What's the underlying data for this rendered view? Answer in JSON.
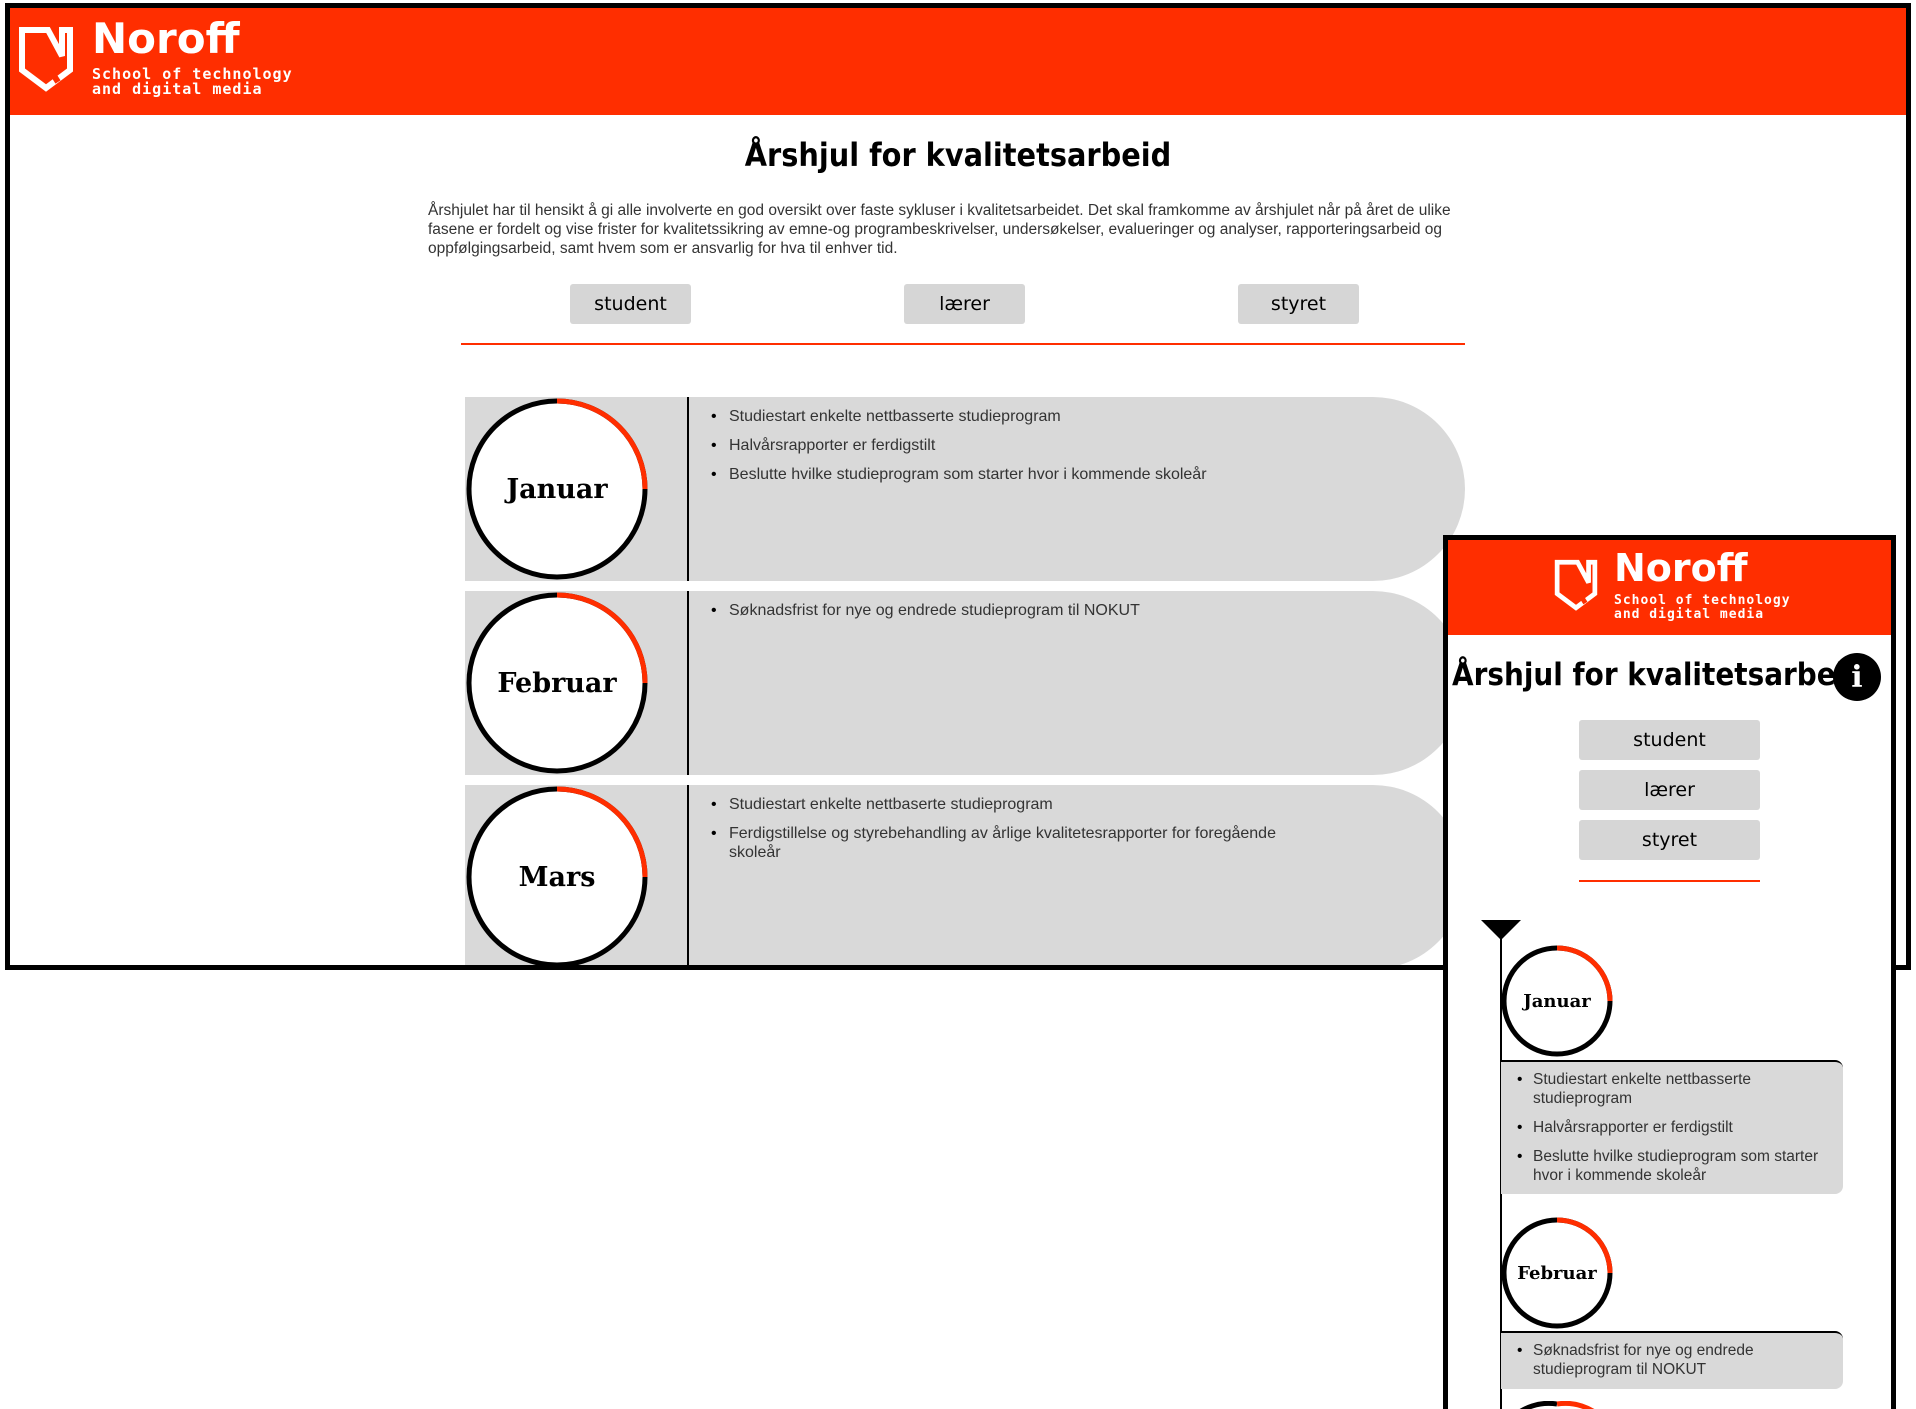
{
  "brand": {
    "name": "Noroff",
    "tagline_line1": "School of technology",
    "tagline_line2": "and digital media",
    "color": "#ff2e00"
  },
  "page": {
    "title": "Årshjul for kvalitetsarbeid",
    "intro": "Årshjulet har til hensikt å gi alle involverte en god oversikt over faste sykluser i kvalitetsarbeidet. Det skal framkomme av årshjulet når på året de ulike fasene er fordelt og vise frister for kvalitetssikring av emne-og programbeskrivelser, undersøkelser, evalueringer og analyser, rapporteringsarbeid og oppfølgingsarbeid, samt hvem som er ansvarlig for hva til enhver tid."
  },
  "filters": {
    "student": "student",
    "teacher": "lærer",
    "board": "styret"
  },
  "desktop_months": [
    {
      "name": "Januar",
      "items": [
        "Studiestart enkelte nettbasserte studieprogram",
        "Halvårsrapporter er ferdigstilt",
        "Beslutte hvilke studieprogram som starter hvor i kommende skoleår"
      ]
    },
    {
      "name": "Februar",
      "items": [
        "Søknadsfrist for nye og endrede studieprogram til NOKUT"
      ]
    },
    {
      "name": "Mars",
      "items": [
        "Studiestart enkelte nettbaserte studieprogram",
        "Ferdigstillelse og styrebehandling av årlige kvalitetesrapporter for foregående skoleår"
      ]
    }
  ],
  "mobile": {
    "info_icon": "info-icon",
    "months": [
      {
        "name": "Januar",
        "items": [
          "Studiestart enkelte nettbasserte studieprogram",
          "Halvårsrapporter er ferdigstilt",
          "Beslutte hvilke studieprogram som starter hvor i kommende skoleår"
        ]
      },
      {
        "name": "Februar",
        "items": [
          "Søknadsfrist for nye og endrede studieprogram til NOKUT"
        ]
      }
    ]
  }
}
